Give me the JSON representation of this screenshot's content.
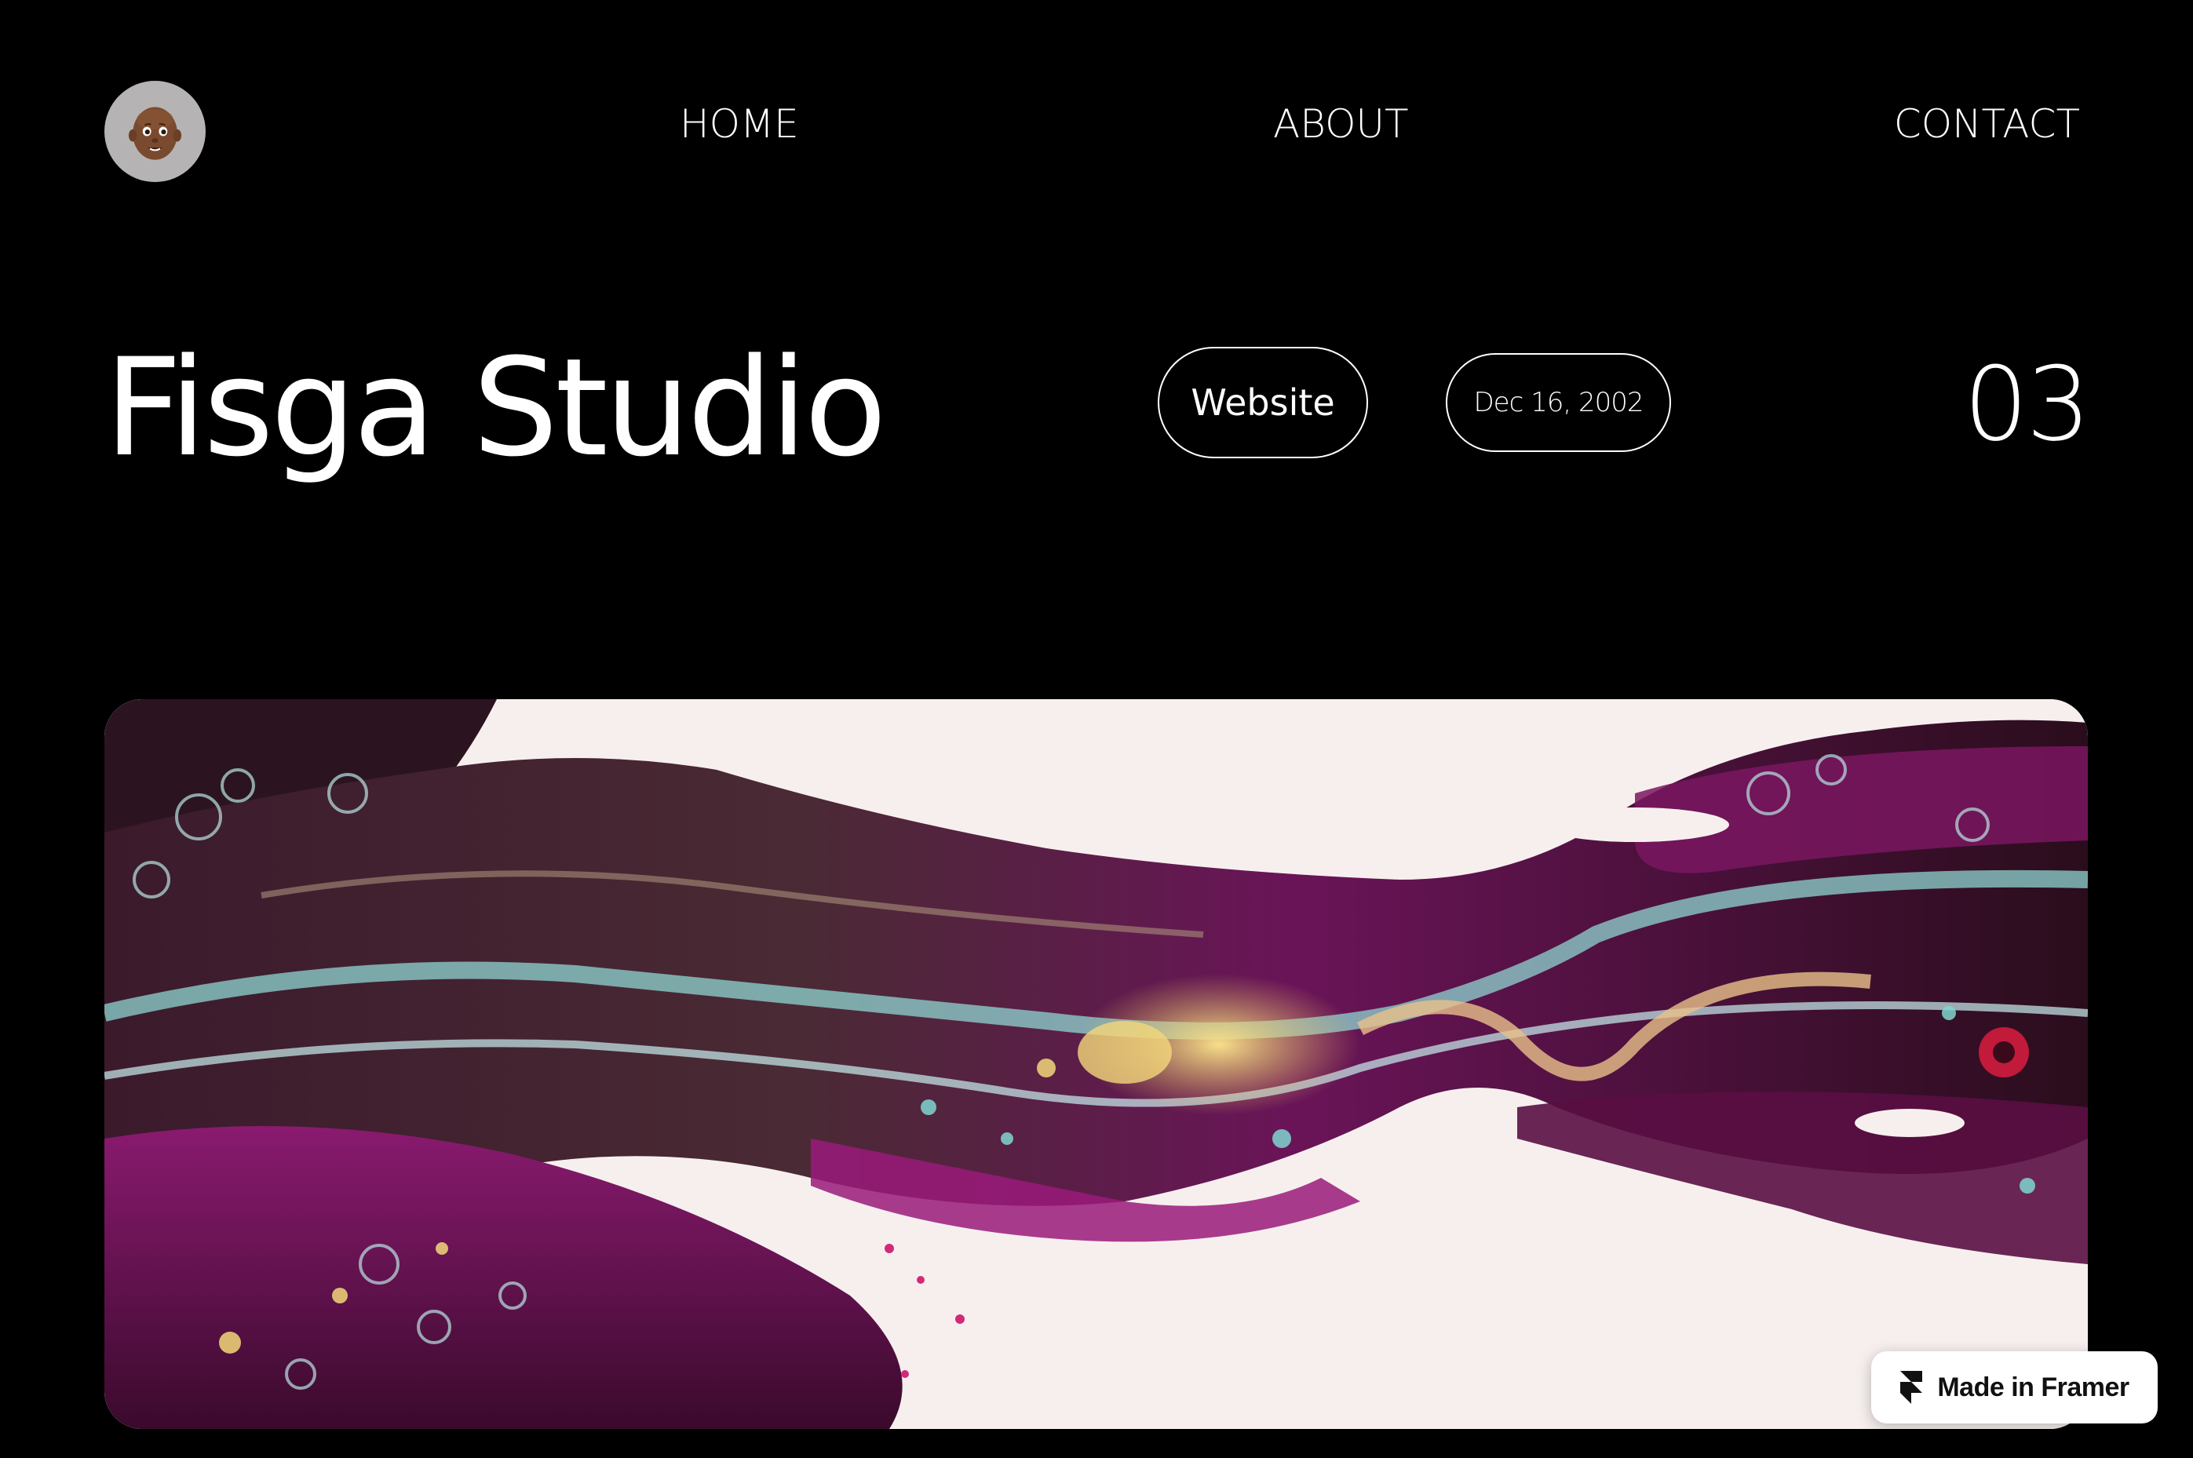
{
  "nav": {
    "home_label": "HOME",
    "about_label": "ABOUT",
    "contact_label": "CONTACT"
  },
  "project": {
    "title": "Fisga Studio",
    "category": "Website",
    "date": "Dec 16, 2002",
    "number": "03"
  },
  "badge": {
    "label": "Made in Framer"
  },
  "icons": {
    "avatar": "memoji-avatar-icon",
    "framer": "framer-logo-icon"
  },
  "colors": {
    "background": "#000000",
    "text": "#ffffff",
    "avatar_bg": "#b5b3b3",
    "image_bg": "#f6efee",
    "accent_purple": "#7a1660",
    "accent_teal": "#6fc9c4",
    "accent_yellow": "#f2d77a"
  }
}
